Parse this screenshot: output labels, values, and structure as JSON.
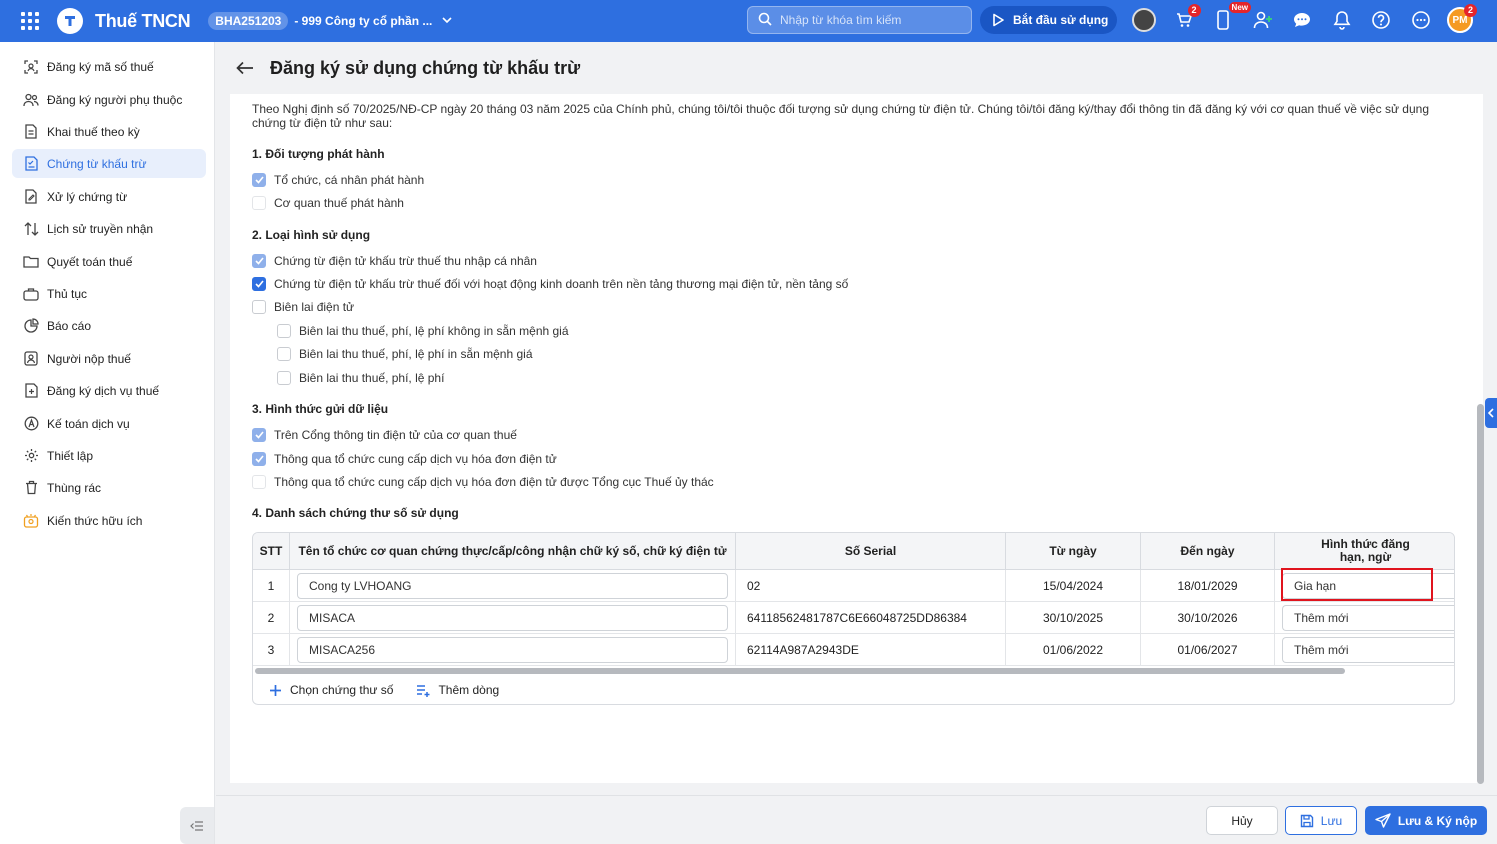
{
  "topbar": {
    "app_title": "Thuế TNCN",
    "company_code": "BHA251203",
    "company_name": "- 999 Công ty cổ phần ...",
    "search_placeholder": "Nhập từ khóa tìm kiếm",
    "start_label": "Bắt đầu sử dụng",
    "cart_badge": "2",
    "new_badge": "New",
    "user_initials": "PM",
    "user_badge": "2"
  },
  "sidebar": {
    "items": [
      {
        "label": "Đăng ký mã số thuế",
        "icon": "scan-icon"
      },
      {
        "label": "Đăng ký người phụ thuộc",
        "icon": "users-icon"
      },
      {
        "label": "Khai thuế theo kỳ",
        "icon": "document-icon"
      },
      {
        "label": "Chứng từ khấu trừ",
        "icon": "receipt-icon"
      },
      {
        "label": "Xử lý chứng từ",
        "icon": "edit-document-icon"
      },
      {
        "label": "Lịch sử truyền nhận",
        "icon": "transfer-icon"
      },
      {
        "label": "Quyết toán thuế",
        "icon": "folder-icon"
      },
      {
        "label": "Thủ tục",
        "icon": "briefcase-icon"
      },
      {
        "label": "Báo cáo",
        "icon": "pie-chart-icon"
      },
      {
        "label": "Người nộp thuế",
        "icon": "person-icon"
      },
      {
        "label": "Đăng ký dịch vụ thuế",
        "icon": "register-service-icon"
      },
      {
        "label": "Kế toán dịch vụ",
        "icon": "accounting-icon"
      },
      {
        "label": "Thiết lập",
        "icon": "gear-icon"
      },
      {
        "label": "Thùng rác",
        "icon": "trash-icon"
      },
      {
        "label": "Kiến thức hữu ích",
        "icon": "knowledge-icon"
      }
    ],
    "active_index": 3
  },
  "page": {
    "title": "Đăng ký sử dụng chứng từ khấu trừ",
    "intro": "Theo Nghị định số 70/2025/NĐ-CP ngày 20 tháng 03 năm 2025 của Chính phủ, chúng tôi/tôi thuộc đối tượng sử dụng chứng từ điện tử. Chúng tôi/tôi đăng ký/thay đổi thông tin đã đăng ký với cơ quan thuế về việc sử dụng chứng từ điện tử như sau:",
    "sections": {
      "s1_title": "1. Đối tượng phát hành",
      "s1_items": [
        {
          "label": "Tổ chức, cá nhân phát hành",
          "state": "checked-dim"
        },
        {
          "label": "Cơ quan thuế phát hành",
          "state": "unchecked-light"
        }
      ],
      "s2_title": "2. Loại hình sử dụng",
      "s2_items": [
        {
          "label": "Chứng từ điện tử khấu trừ thuế thu nhập cá nhân",
          "state": "checked-dim"
        },
        {
          "label": "Chứng từ điện tử khấu trừ thuế đối với hoạt động kinh doanh trên nền tảng thương mại điện tử, nền tảng số",
          "state": "checked"
        },
        {
          "label": "Biên lai điện tử",
          "state": "unchecked"
        },
        {
          "label": "Biên lai thu thuế, phí, lệ phí không in sẵn mệnh giá",
          "state": "unchecked"
        },
        {
          "label": "Biên lai thu thuế, phí, lệ phí in sẵn mệnh giá",
          "state": "unchecked"
        },
        {
          "label": "Biên lai thu thuế, phí, lệ phí",
          "state": "unchecked"
        }
      ],
      "s3_title": "3. Hình thức gửi dữ liệu",
      "s3_items": [
        {
          "label": "Trên Cổng thông tin điện tử của cơ quan thuế",
          "state": "checked-dim"
        },
        {
          "label": "Thông qua tổ chức cung cấp dịch vụ hóa đơn điện tử",
          "state": "checked-dim"
        },
        {
          "label": "Thông qua tổ chức cung cấp dịch vụ hóa đơn điện tử được Tổng cục Thuế ủy thác",
          "state": "unchecked-light"
        }
      ],
      "s4_title": "4. Danh sách chứng thư số sử dụng"
    },
    "table": {
      "headers": {
        "stt": "STT",
        "org": "Tên tổ chức cơ quan chứng thực/cấp/công nhận chữ ký số, chữ ký điện tử",
        "serial": "Số Serial",
        "from": "Từ ngày",
        "to": "Đến ngày",
        "form_line1": "Hình thức đăng",
        "form_line2": "hạn, ngừ"
      },
      "rows": [
        {
          "stt": "1",
          "org": "Cong ty LVHOANG",
          "serial": "02",
          "from": "15/04/2024",
          "to": "18/01/2029",
          "form": "Gia hạn"
        },
        {
          "stt": "2",
          "org": "MISACA",
          "serial": "64118562481787C6E66048725DD86384",
          "from": "30/10/2025",
          "to": "30/10/2026",
          "form": "Thêm mới"
        },
        {
          "stt": "3",
          "org": "MISACA256",
          "serial": "62114A987A2943DE",
          "from": "01/06/2022",
          "to": "01/06/2027",
          "form": "Thêm mới"
        }
      ],
      "footer": {
        "choose_cert": "Chọn chứng thư số",
        "add_row": "Thêm dòng"
      }
    }
  },
  "actions": {
    "cancel": "Hủy",
    "save": "Lưu",
    "save_submit": "Lưu & Ký nộp"
  },
  "colors": {
    "primary": "#2e6fe0",
    "highlight": "#e0141e"
  }
}
